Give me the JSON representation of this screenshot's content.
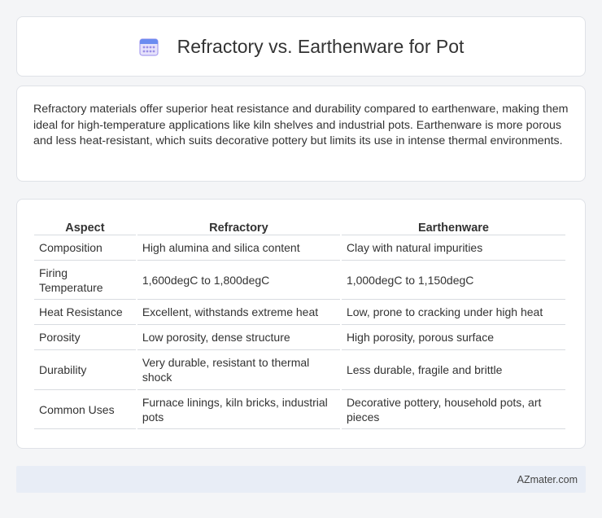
{
  "header": {
    "title": "Refractory vs. Earthenware for Pot",
    "icon": "calendar-icon"
  },
  "summary": {
    "text": "Refractory materials offer superior heat resistance and durability compared to earthenware, making them ideal for high-temperature applications like kiln shelves and industrial pots. Earthenware is more porous and less heat-resistant, which suits decorative pottery but limits its use in intense thermal environments."
  },
  "table": {
    "headers": [
      "Aspect",
      "Refractory",
      "Earthenware"
    ],
    "rows": [
      {
        "aspect": "Composition",
        "refractory": "High alumina and silica content",
        "earthenware": "Clay with natural impurities"
      },
      {
        "aspect": "Firing Temperature",
        "refractory": "1,600degC to 1,800degC",
        "earthenware": "1,000degC to 1,150degC"
      },
      {
        "aspect": "Heat Resistance",
        "refractory": "Excellent, withstands extreme heat",
        "earthenware": "Low, prone to cracking under high heat"
      },
      {
        "aspect": "Porosity",
        "refractory": "Low porosity, dense structure",
        "earthenware": "High porosity, porous surface"
      },
      {
        "aspect": "Durability",
        "refractory": "Very durable, resistant to thermal shock",
        "earthenware": "Less durable, fragile and brittle"
      },
      {
        "aspect": "Common Uses",
        "refractory": "Furnace linings, kiln bricks, industrial pots",
        "earthenware": "Decorative pottery, household pots, art pieces"
      }
    ]
  },
  "footer": {
    "text": "AZmater.com"
  },
  "colors": {
    "background": "#f4f5f7",
    "card": "#ffffff",
    "footer_bg": "#e8edf6",
    "icon_accent": "#7b6fd8"
  }
}
